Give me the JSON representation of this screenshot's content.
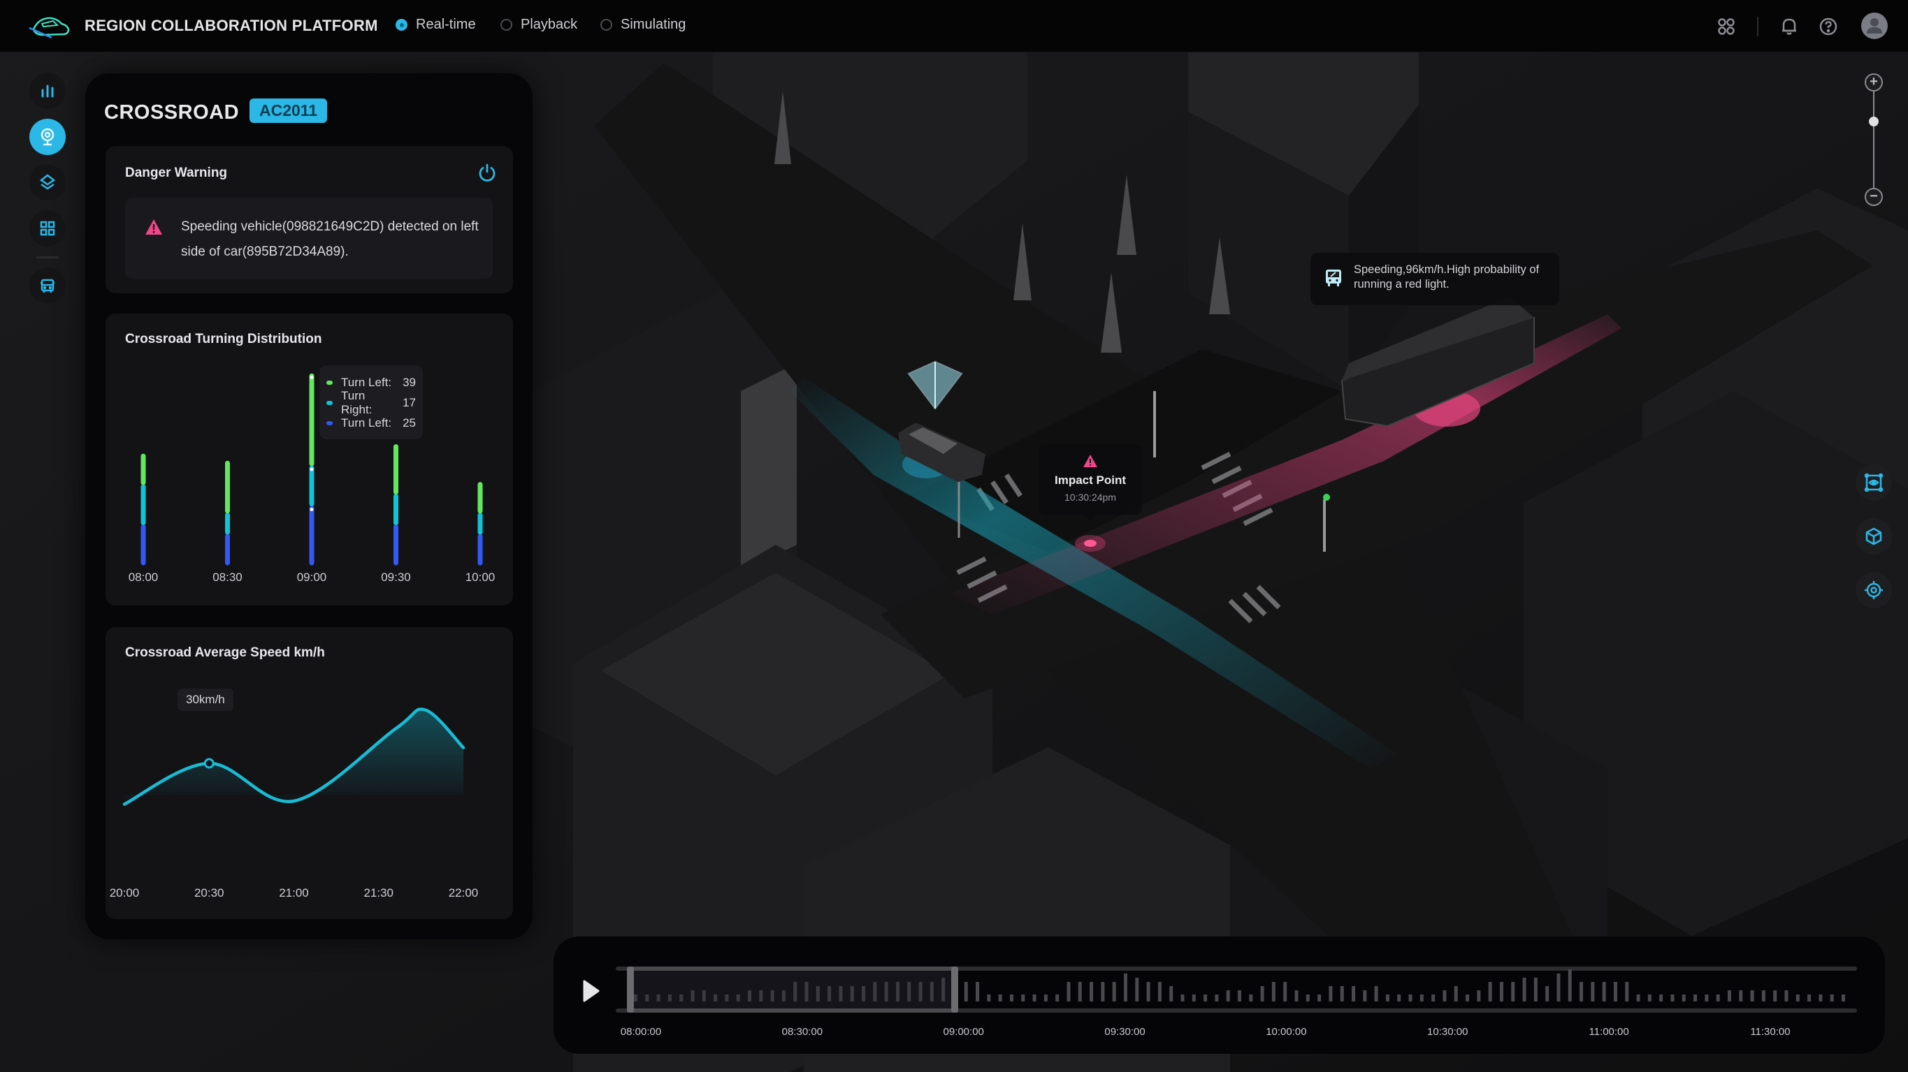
{
  "app": {
    "title": "REGION COLLABORATION PLATFORM",
    "logo_icon": "car-outline-icon",
    "modes": [
      {
        "label": "Real-time",
        "selected": true
      },
      {
        "label": "Playback",
        "selected": false
      },
      {
        "label": "Simulating",
        "selected": false
      }
    ],
    "header_icons": [
      "apps-grid-icon",
      "bell-icon",
      "help-icon",
      "user-avatar-icon"
    ]
  },
  "sidebar": {
    "items": [
      {
        "icon": "bar-chart-icon",
        "active": false
      },
      {
        "icon": "camera-icon",
        "active": true
      },
      {
        "icon": "layers-icon",
        "active": false
      },
      {
        "icon": "grid-icon",
        "active": false
      },
      {
        "icon": "bus-icon",
        "active": false
      }
    ]
  },
  "panel": {
    "title": "CROSSROAD",
    "badge": "AC2011",
    "danger": {
      "title": "Danger Warning",
      "message": "Speeding vehicle(098821649C2D) detected on left side of car(895B72D34A89).",
      "icon": "warning-triangle-icon",
      "toggle_icon": "power-icon"
    },
    "turning": {
      "title": "Crossroad Turning Distribution"
    },
    "speed": {
      "title": "Crossroad Average Speed  km/h",
      "tooltip": "30km/h"
    }
  },
  "chart_data": [
    {
      "type": "bar",
      "stacked": true,
      "title": "Crossroad Turning Distribution",
      "categories": [
        "08:00",
        "08:30",
        "09:00",
        "09:30",
        "10:00"
      ],
      "series": [
        {
          "name": "Turn Left",
          "color": "#3358f5",
          "values": [
            17,
            13,
            25,
            17,
            13
          ]
        },
        {
          "name": "Turn Right",
          "color": "#10c3d8",
          "values": [
            17,
            9,
            17,
            13,
            9
          ]
        },
        {
          "name": "Turn Left",
          "color": "#62e85f",
          "values": [
            13,
            22,
            39,
            21,
            13
          ]
        }
      ],
      "tooltip": {
        "category": "09:00",
        "rows": [
          {
            "name": "Turn Left:",
            "value": "39",
            "color": "#62e85f"
          },
          {
            "name": "Turn Right:",
            "value": "17",
            "color": "#10c3d8"
          },
          {
            "name": "Turn Left:",
            "value": "25",
            "color": "#3358f5"
          }
        ]
      },
      "legend": "tooltip",
      "grid": false
    },
    {
      "type": "area",
      "title": "Crossroad Average Speed  km/h",
      "xlabel": "",
      "ylabel": "km/h",
      "x": [
        "20:00",
        "20:30",
        "21:00",
        "21:30",
        "22:00"
      ],
      "points": [
        [
          0,
          17
        ],
        [
          1,
          30
        ],
        [
          2,
          18
        ],
        [
          3.2,
          41
        ],
        [
          3.55,
          47
        ],
        [
          4,
          35
        ]
      ],
      "highlight": {
        "x": "20:30",
        "value": 30,
        "label": "30km/h"
      },
      "ylim": [
        0,
        60
      ],
      "color": "#18bcd4",
      "grid": false
    }
  ],
  "map": {
    "bus_alert": {
      "icon": "bus-icon",
      "text": "Speeding,96km/h.High probability of running a red light."
    },
    "impact": {
      "icon": "warning-triangle-icon",
      "title": "Impact Point",
      "time": "10:30:24pm"
    },
    "zoom_level": 0.69,
    "tools": [
      "view-frame-icon",
      "cube-icon",
      "locate-target-icon"
    ]
  },
  "timeline": {
    "play_icon": "play-icon",
    "ticks": [
      "08:00:00",
      "08:30:00",
      "09:00:00",
      "09:30:00",
      "10:00:00",
      "10:30:00",
      "11:00:00",
      "11:30:00"
    ],
    "selection": {
      "start": "08:00:00",
      "end": "09:00:00"
    },
    "activity": [
      1,
      1,
      1,
      1,
      1,
      2,
      2,
      1,
      1,
      1,
      2,
      2,
      2,
      2,
      4,
      4,
      3,
      3,
      3,
      3,
      3,
      4,
      4,
      4,
      4,
      4,
      4,
      5,
      5,
      4,
      4,
      1,
      1,
      1,
      1,
      1,
      1,
      1,
      4,
      4,
      4,
      4,
      4,
      6,
      5,
      4,
      4,
      3,
      1,
      1,
      1,
      1,
      2,
      2,
      1,
      3,
      4,
      4,
      2,
      1,
      1,
      3,
      3,
      3,
      2,
      3,
      1,
      1,
      1,
      1,
      1,
      2,
      3,
      1,
      2,
      4,
      4,
      4,
      5,
      5,
      3,
      6,
      7,
      4,
      4,
      4,
      4,
      4,
      1,
      1,
      1,
      1,
      1,
      1,
      1,
      1,
      2,
      2,
      2,
      2,
      2,
      2,
      1,
      1,
      1,
      1,
      1
    ]
  }
}
